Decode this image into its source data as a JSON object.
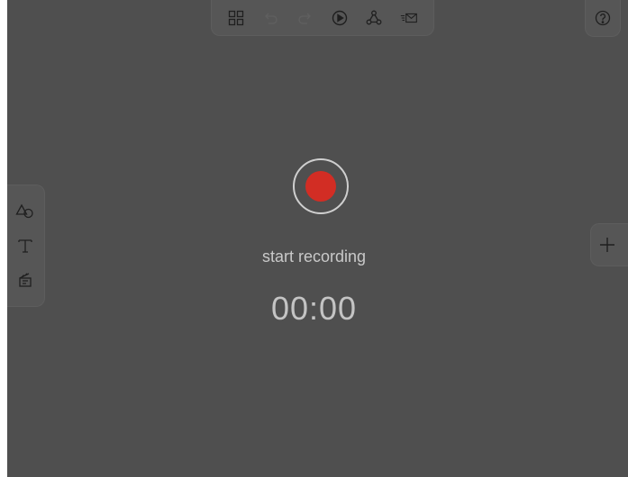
{
  "toolbar": {
    "icons": [
      "grid-icon",
      "undo-icon",
      "redo-icon",
      "play-icon",
      "share-nodes-icon",
      "send-mail-icon"
    ],
    "help_icon": "help-icon"
  },
  "left_toolbar": {
    "icons": [
      "shapes-icon",
      "text-icon",
      "media-icon"
    ],
    "text_glyph": "T"
  },
  "right_panel": {
    "add_glyph": "+"
  },
  "recorder": {
    "label": "start recording",
    "time": "00:00"
  },
  "colors": {
    "background": "#4f4f4f",
    "record": "#d22d24",
    "icon": "#1f1f1f"
  }
}
